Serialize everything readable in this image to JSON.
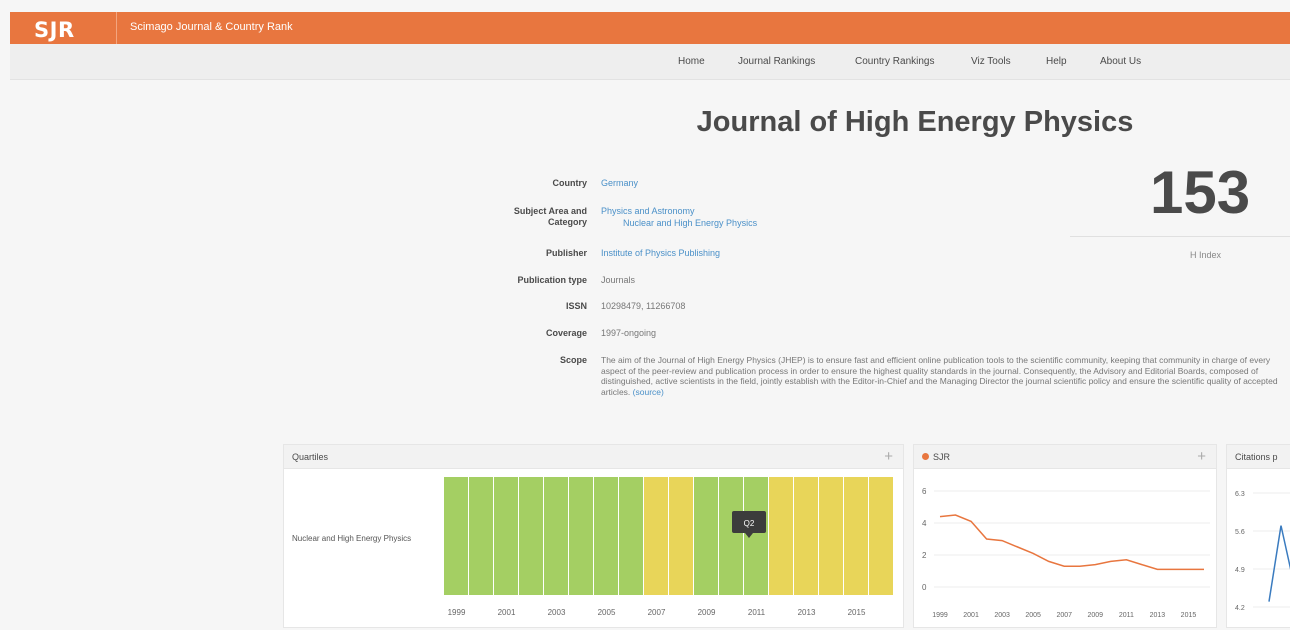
{
  "header": {
    "logo": "SJR",
    "tagline": "Scimago Journal & Country Rank"
  },
  "nav": {
    "items": [
      "Home",
      "Journal Rankings",
      "Country Rankings",
      "Viz Tools",
      "Help",
      "About Us"
    ]
  },
  "journal": {
    "title": "Journal of High Energy Physics",
    "fields": {
      "country_label": "Country",
      "country_value": "Germany",
      "subject_label_1": "Subject Area and",
      "subject_label_2": "Category",
      "subject_value": "Physics and Astronomy",
      "category_value": "Nuclear and High Energy Physics",
      "publisher_label": "Publisher",
      "publisher_value": "Institute of Physics Publishing",
      "pubtype_label": "Publication type",
      "pubtype_value": "Journals",
      "issn_label": "ISSN",
      "issn_value": "10298479, 11266708",
      "coverage_label": "Coverage",
      "coverage_value": "1997-ongoing",
      "scope_label": "Scope",
      "scope_value": "The aim of the Journal of High Energy Physics (JHEP) is to ensure fast and efficient online publication tools to the scientific community, keeping that community in charge of every aspect of the peer-review and publication process in order to ensure the highest quality standards in the journal. Consequently, the Advisory and Editorial Boards, composed of distinguished, active scientists in the field, jointly establish with the Editor-in-Chief and the Managing Director the journal scientific policy and ensure the scientific quality of accepted articles.",
      "scope_source": "(source)"
    },
    "h_index": {
      "value": "153",
      "label": "H Index"
    }
  },
  "panels": {
    "quartiles_title": "Quartiles",
    "sjr_title": "SJR",
    "citations_title": "Citations p",
    "plus": "+"
  },
  "chart_data": [
    {
      "type": "heatmap",
      "title": "Quartiles",
      "row_label": "Nuclear and High Energy Physics",
      "years": [
        1999,
        2000,
        2001,
        2002,
        2003,
        2004,
        2005,
        2006,
        2007,
        2008,
        2009,
        2010,
        2011,
        2012,
        2013,
        2014,
        2015,
        2016
      ],
      "quartiles": [
        "Q1",
        "Q1",
        "Q1",
        "Q1",
        "Q1",
        "Q1",
        "Q1",
        "Q1",
        "Q2",
        "Q2",
        "Q1",
        "Q1",
        "Q1",
        "Q2",
        "Q2",
        "Q2",
        "Q2",
        "Q2"
      ],
      "x_tick_labels": [
        "1999",
        "2001",
        "2003",
        "2005",
        "2007",
        "2009",
        "2011",
        "2013",
        "2015"
      ],
      "tooltip": "Q2",
      "colors": {
        "Q1": "#a4cf63",
        "Q2": "#e8d559"
      }
    },
    {
      "type": "line",
      "title": "SJR",
      "x": [
        1999,
        2000,
        2001,
        2002,
        2003,
        2004,
        2005,
        2006,
        2007,
        2008,
        2009,
        2010,
        2011,
        2012,
        2013,
        2014,
        2015,
        2016
      ],
      "series": [
        {
          "name": "SJR",
          "color": "#e8763f",
          "values": [
            4.4,
            4.5,
            4.1,
            3.0,
            2.9,
            2.5,
            2.1,
            1.6,
            1.3,
            1.3,
            1.4,
            1.6,
            1.7,
            1.4,
            1.1,
            1.1,
            1.1,
            1.1
          ]
        }
      ],
      "ylim": [
        0,
        6
      ],
      "y_ticks": [
        0,
        2,
        4,
        6
      ],
      "x_tick_labels": [
        "1999",
        "2001",
        "2003",
        "2005",
        "2007",
        "2009",
        "2011",
        "2013",
        "2015"
      ]
    },
    {
      "type": "line",
      "title": "Citations p",
      "y_tick_labels": [
        "6.3",
        "5.6",
        "4.9",
        "4.2"
      ],
      "ylim": [
        4.2,
        6.3
      ],
      "series": [
        {
          "name": "Citations",
          "color": "#3a7bbf",
          "values": [
            4.3,
            5.7,
            4.7
          ]
        }
      ]
    }
  ]
}
